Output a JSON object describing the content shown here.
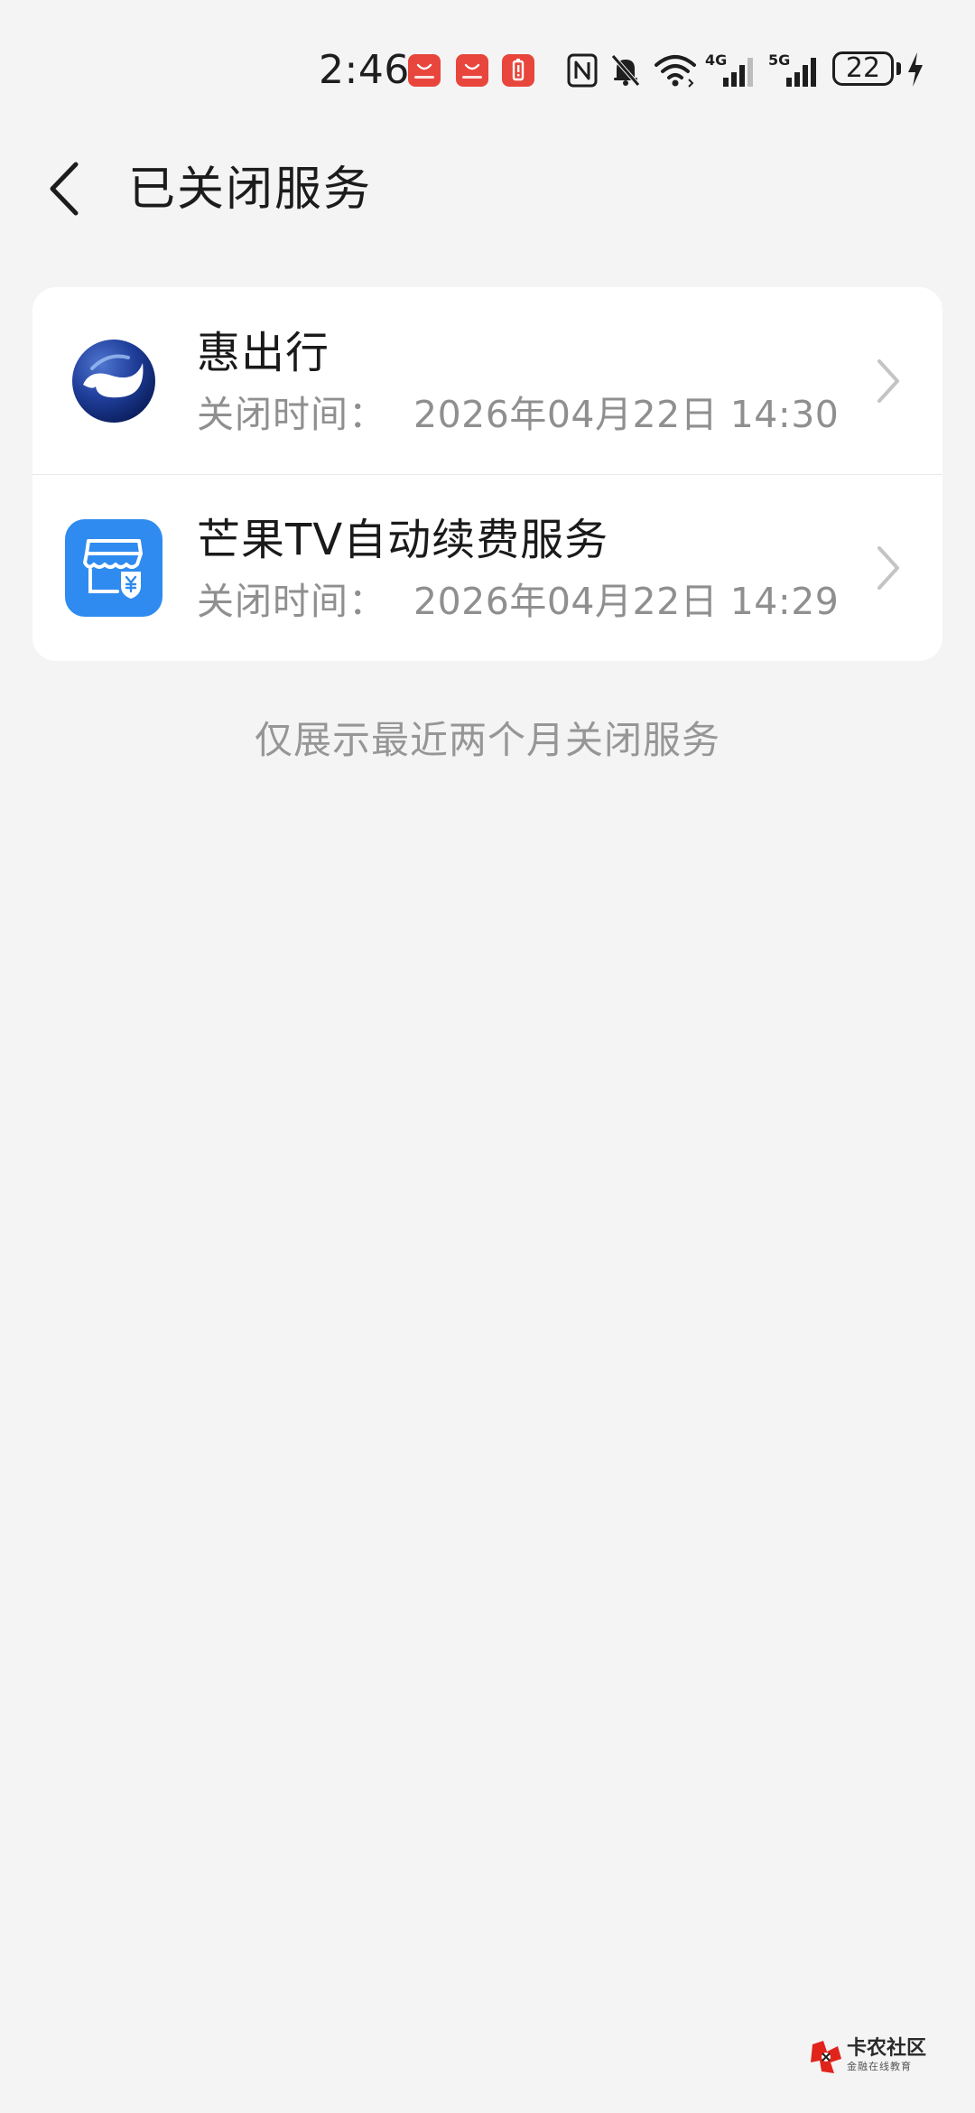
{
  "status_bar": {
    "time": "2:46",
    "battery_level": "22",
    "signal_1_label": "4G",
    "signal_2_label": "5G",
    "notification_icons": [
      "huawei-appgallery-icon",
      "huawei-appgallery-icon",
      "battery-alert-icon"
    ],
    "system_icons": [
      "nfc-icon",
      "bell-muted-icon",
      "wifi-icon",
      "signal-4g-icon",
      "signal-5g-icon",
      "battery-icon",
      "charging-icon"
    ]
  },
  "header": {
    "title": "已关闭服务",
    "back_icon": "chevron-left-icon"
  },
  "services": [
    {
      "name": "惠出行",
      "close_label": "关闭时间：",
      "close_time": "2026年04月22日 14:30",
      "icon": "huichuxing-logo-icon"
    },
    {
      "name": "芒果TV自动续费服务",
      "close_label": "关闭时间：",
      "close_time": "2026年04月22日 14:29",
      "icon": "store-payment-icon"
    }
  ],
  "footer_note": "仅展示最近两个月关闭服务",
  "watermark": {
    "title": "卡农社区",
    "subtitle": "金融在线教育"
  },
  "colors": {
    "background": "#f4f4f4",
    "card": "#ffffff",
    "accent_blue": "#2f8bf0",
    "notification_red": "#e8463c",
    "secondary_text": "#8f8f8f"
  }
}
